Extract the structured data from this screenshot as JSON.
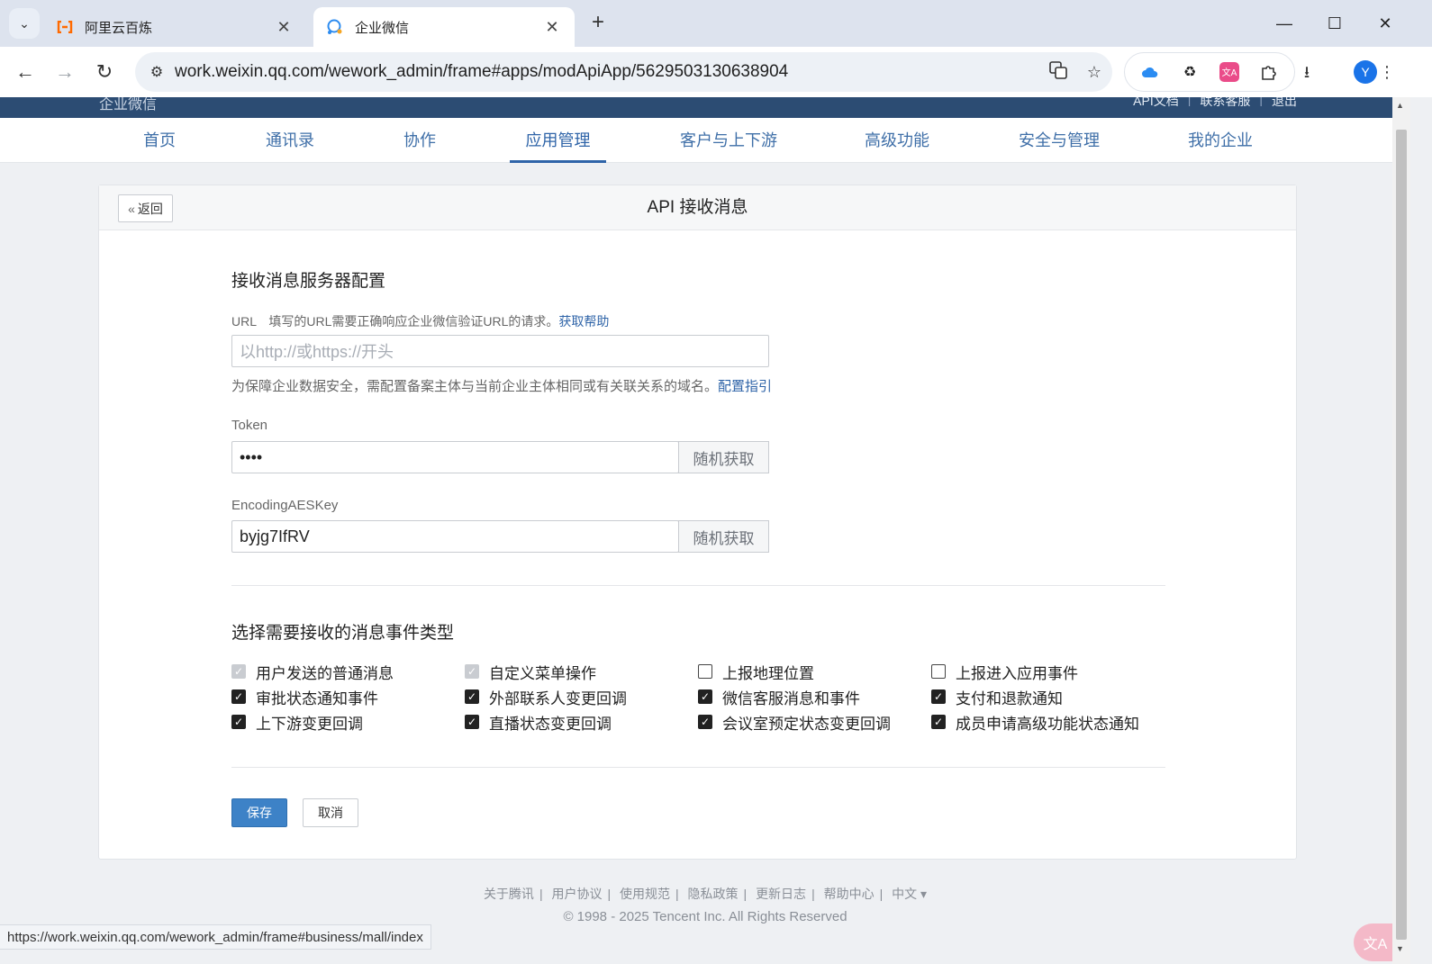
{
  "browser": {
    "tabs": [
      {
        "title": "阿里云百炼",
        "favicon": "aliyun-icon",
        "active": false
      },
      {
        "title": "企业微信",
        "favicon": "wework-icon",
        "active": true
      }
    ],
    "url": "work.weixin.qq.com/wework_admin/frame#apps/modApiApp/5629503130638904",
    "profile_initial": "Y",
    "status_url": "https://work.weixin.qq.com/wework_admin/frame#business/mall/index"
  },
  "header": {
    "logo_text": "企业微信",
    "links": [
      "API文档",
      "联系客服",
      "退出"
    ]
  },
  "nav": {
    "items": [
      "首页",
      "通讯录",
      "协作",
      "应用管理",
      "客户与上下游",
      "高级功能",
      "安全与管理",
      "我的企业"
    ],
    "active": "应用管理"
  },
  "card": {
    "back_label": "返回",
    "title": "API 接收消息"
  },
  "server_config": {
    "title": "接收消息服务器配置",
    "url_label": "URL",
    "url_desc": "填写的URL需要正确响应企业微信验证URL的请求。",
    "url_help": "获取帮助",
    "url_placeholder": "以http://或https://开头",
    "url_hint": "为保障企业数据安全，需配置备案主体与当前企业主体相同或有关联关系的域名。",
    "url_hint_link": "配置指引",
    "token_label": "Token",
    "token_value": "••••",
    "aeskey_label": "EncodingAESKey",
    "aeskey_value": "byjg7IfRV",
    "random_button": "随机获取"
  },
  "events": {
    "title": "选择需要接收的消息事件类型",
    "items": [
      {
        "label": "用户发送的普通消息",
        "state": "disabled"
      },
      {
        "label": "自定义菜单操作",
        "state": "disabled"
      },
      {
        "label": "上报地理位置",
        "state": "unchecked"
      },
      {
        "label": "上报进入应用事件",
        "state": "unchecked"
      },
      {
        "label": "审批状态通知事件",
        "state": "checked"
      },
      {
        "label": "外部联系人变更回调",
        "state": "checked"
      },
      {
        "label": "微信客服消息和事件",
        "state": "checked"
      },
      {
        "label": "支付和退款通知",
        "state": "checked"
      },
      {
        "label": "上下游变更回调",
        "state": "checked"
      },
      {
        "label": "直播状态变更回调",
        "state": "checked"
      },
      {
        "label": "会议室预定状态变更回调",
        "state": "checked"
      },
      {
        "label": "成员申请高级功能状态通知",
        "state": "checked"
      }
    ]
  },
  "actions": {
    "save": "保存",
    "cancel": "取消"
  },
  "footer": {
    "links": [
      "关于腾讯",
      "用户协议",
      "使用规范",
      "隐私政策",
      "更新日志",
      "帮助中心",
      "中文 ▾"
    ],
    "copyright": "© 1998 - 2025 Tencent Inc. All Rights Reserved"
  },
  "colors": {
    "header_bg": "#2c4c73",
    "nav_link": "#3f6fa8",
    "primary_button": "#3d82c7",
    "link": "#2f64a8"
  }
}
